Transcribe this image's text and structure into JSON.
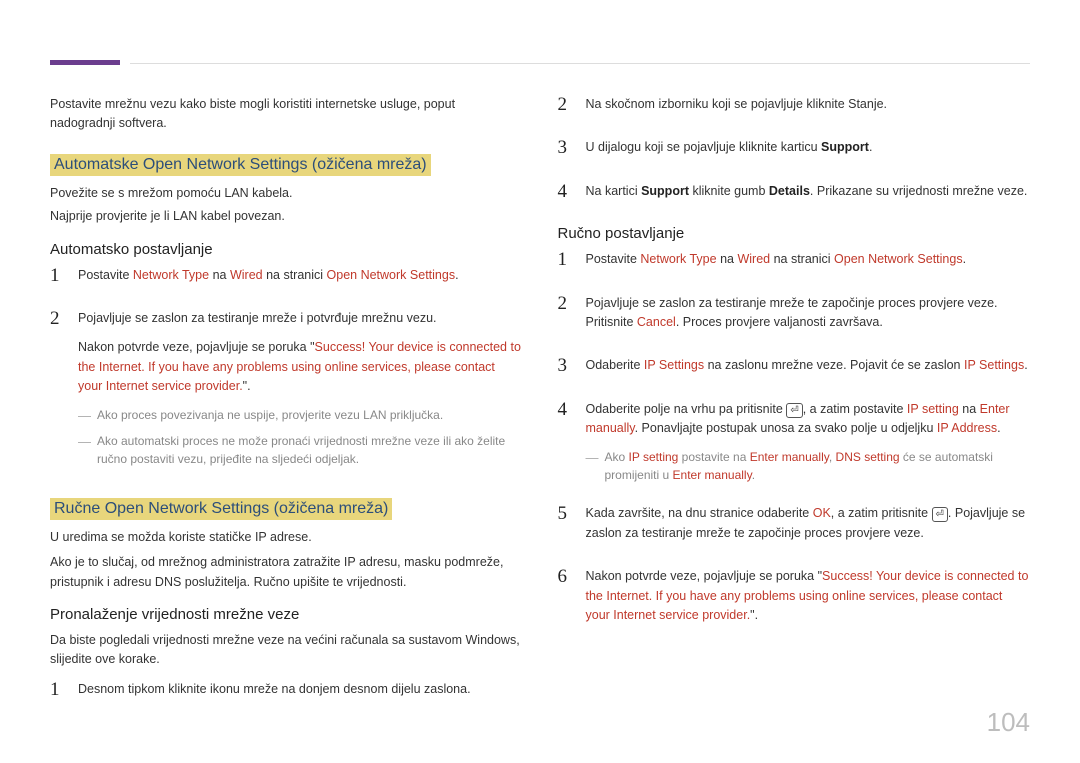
{
  "page_number": "104",
  "col1": {
    "intro": "Postavite mrežnu vezu kako biste mogli koristiti internetske usluge, poput nadogradnji softvera.",
    "section1_title": "Automatske  Open Network Settings (ožičena mreža)",
    "s1_line1": "Povežite se s mrežom pomoću LAN kabela.",
    "s1_line2": "Najprije provjerite je li LAN kabel povezan.",
    "s1_sub": "Automatsko postavljanje",
    "s1_step1_a": "Postavite ",
    "s1_step1_hl1": "Network Type",
    "s1_step1_b": " na ",
    "s1_step1_hl2": "Wired",
    "s1_step1_c": " na stranici ",
    "s1_step1_hl3": "Open Network Settings",
    "s1_step1_d": ".",
    "s1_step2": "Pojavljuje se zaslon za testiranje mreže i potvrđuje mrežnu vezu.",
    "s1_step2_p2_a": "Nakon potvrde veze, pojavljuje se poruka \"",
    "s1_step2_p2_hl": "Success! Your device is connected to the Internet. If you have any problems using online services, please contact your Internet service provider.",
    "s1_step2_p2_b": "\".",
    "s1_note1": "Ako proces povezivanja ne uspije, provjerite vezu LAN priključka.",
    "s1_note2": "Ako automatski proces ne može pronaći vrijednosti mrežne veze ili ako želite ručno postaviti vezu, prijeđite na sljedeći odjeljak.",
    "section2_title": "Ručne Open Network Settings (ožičena mreža)",
    "s2_line1": "U uredima se možda koriste statičke IP adrese.",
    "s2_line2": "Ako je to slučaj, od mrežnog administratora zatražite IP adresu, masku podmreže, pristupnik i adresu DNS poslužitelja. Ručno upišite te vrijednosti.",
    "s2_sub": "Pronalaženje vrijednosti mrežne veze",
    "s2_line3": "Da biste pogledali vrijednosti mrežne veze na većini računala sa sustavom Windows, slijedite ove korake.",
    "s2_step1": "Desnom tipkom kliknite ikonu mreže na donjem desnom dijelu zaslona."
  },
  "col2": {
    "step2": "Na skočnom izborniku koji se pojavljuje kliknite Stanje.",
    "step3_a": "U dijalogu koji se pojavljuje kliknite karticu ",
    "step3_b": "Support",
    "step3_c": ".",
    "step4_a": "Na kartici ",
    "step4_b": "Support",
    "step4_c": " kliknite gumb ",
    "step4_d": "Details",
    "step4_e": ". Prikazane su vrijednosti mrežne veze.",
    "sub": "Ručno postavljanje",
    "r1_a": "Postavite ",
    "r1_hl1": "Network Type",
    "r1_b": " na ",
    "r1_hl2": "Wired",
    "r1_c": " na stranici ",
    "r1_hl3": "Open Network Settings",
    "r1_d": ".",
    "r2_a": "Pojavljuje se zaslon za testiranje mreže te započinje proces provjere veze. Pritisnite ",
    "r2_hl": "Cancel",
    "r2_b": ". Proces provjere valjanosti završava.",
    "r3_a": "Odaberite ",
    "r3_hl1": "IP Settings",
    "r3_b": " na zaslonu mrežne veze. Pojavit će se zaslon ",
    "r3_hl2": "IP Settings",
    "r3_c": ".",
    "r4_a": "Odaberite polje na vrhu pa pritisnite ",
    "r4_b": ", a zatim postavite ",
    "r4_hl1": "IP setting",
    "r4_c": " na ",
    "r4_hl2": "Enter manually",
    "r4_d": ". Ponavljajte postupak unosa za svako polje u odjeljku ",
    "r4_hl3": "IP Address",
    "r4_e": ".",
    "r4_note_a": "Ako ",
    "r4_note_hl1": "IP setting",
    "r4_note_b": " postavite na ",
    "r4_note_hl2": "Enter manually",
    "r4_note_c": ", ",
    "r4_note_hl3": "DNS setting",
    "r4_note_d": " će se automatski promijeniti u ",
    "r4_note_hl4": "Enter manually",
    "r4_note_e": ".",
    "r5_a": "Kada završite, na dnu stranice odaberite ",
    "r5_hl": "OK",
    "r5_b": ", a zatim pritisnite ",
    "r5_c": ". Pojavljuje se zaslon za testiranje mreže te započinje proces provjere veze.",
    "r6_a": "Nakon potvrde veze, pojavljuje se poruka \"",
    "r6_hl": "Success! Your device is connected to the Internet. If you have any problems using online services, please contact your Internet service provider.",
    "r6_b": "\"."
  }
}
